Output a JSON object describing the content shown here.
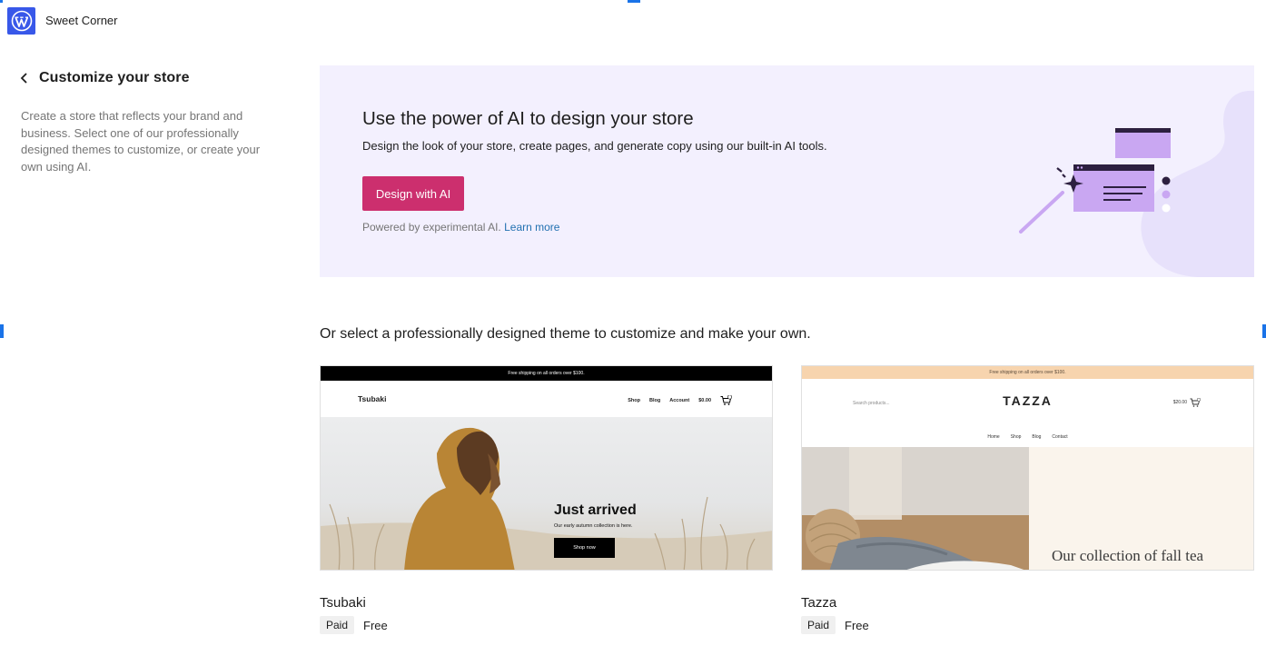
{
  "topbar": {
    "site_name": "Sweet Corner",
    "logo_icon": "wordpress-logo-icon",
    "logo_color": "#3858e9"
  },
  "sidebar": {
    "back_icon": "chevron-left-icon",
    "title": "Customize your store",
    "description": "Create a store that reflects your brand and business. Select one of our professionally designed themes to customize, or create your own using AI."
  },
  "ai_banner": {
    "title": "Use the power of AI to design your store",
    "subtitle": "Design the look of your store, create pages, and generate copy using our built-in AI tools.",
    "button_label": "Design with AI",
    "button_color": "#cc2f6e",
    "powered_text": "Powered by experimental AI.",
    "learn_more": "Learn more",
    "background_color": "#f3f0fe",
    "illustration_icon": "ai-magic-wand-illustration-icon"
  },
  "themes_section": {
    "heading": "Or select a professionally designed theme to customize and make your own.",
    "themes": [
      {
        "name": "Tsubaki",
        "badge": "Paid",
        "price": "Free",
        "preview": {
          "strip": "Free shipping on all orders over $100.",
          "logo": "Tsubaki",
          "nav": [
            "Shop",
            "Blog",
            "Account",
            "$0.00"
          ],
          "hero_title": "Just arrived",
          "hero_sub": "Our early autumn collection is here.",
          "hero_button": "Shop now"
        }
      },
      {
        "name": "Tazza",
        "badge": "Paid",
        "price": "Free",
        "preview": {
          "strip": "Free shipping on all orders over $100.",
          "search": "Search products...",
          "logo": "TAZZA",
          "cart": "$20.00",
          "nav": [
            "Home",
            "Shop",
            "Blog",
            "Contact"
          ],
          "hero_text": "Our collection of fall tea"
        }
      }
    ]
  }
}
